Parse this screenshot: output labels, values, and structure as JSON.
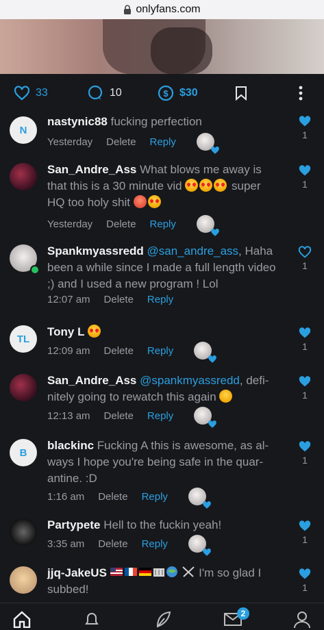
{
  "browser": {
    "url": "onlyfans.com"
  },
  "post": {
    "likes": "33",
    "comments_count": "10",
    "tip": "$30"
  },
  "comments": [
    {
      "avatar_initials": "N",
      "username": "nastynic88",
      "body": "fucking perfection",
      "time": "Yesterday",
      "delete": "Delete",
      "reply": "Reply",
      "likes": "1",
      "liked": true
    },
    {
      "username": "San_Andre_Ass",
      "body": "What blows me away is that this is a 30 minute vid",
      "body_after_emoji": "super HQ too holy shit",
      "time": "Yesterday",
      "delete": "Delete",
      "reply": "Reply",
      "likes": "1",
      "liked": true
    },
    {
      "username": "Spankmyassredd",
      "mention": "@san_andre_ass",
      "body": ", Haha been a while since I made a full length video ;) and I used a new program ! Lol",
      "time": "12:07 am",
      "delete": "Delete",
      "reply": "Reply",
      "likes": "1",
      "liked": false
    },
    {
      "avatar_initials": "TL",
      "username": "Tony L",
      "time": "12:09 am",
      "delete": "Delete",
      "reply": "Reply",
      "likes": "1",
      "liked": true
    },
    {
      "username": "San_Andre_Ass",
      "mention": "@spankmyassredd",
      "body": ", defi-nitely going to rewatch this again",
      "time": "12:13 am",
      "delete": "Delete",
      "reply": "Reply",
      "likes": "1",
      "liked": true
    },
    {
      "avatar_initials": "B",
      "username": "blackinc",
      "body": "Fucking A this is awesome, as al-ways I hope you're being safe in the quar-antine. :D",
      "time": "1:16 am",
      "delete": "Delete",
      "reply": "Reply",
      "likes": "1",
      "liked": true
    },
    {
      "username": "Partypete",
      "body": "Hell to the fuckin yeah!",
      "time": "3:35 am",
      "delete": "Delete",
      "reply": "Reply",
      "likes": "1",
      "liked": true
    },
    {
      "username": "jjq-JakeUS",
      "body": "I'm so glad I subbed!",
      "likes": "1",
      "liked": true
    }
  ],
  "nav": {
    "messages_badge": "2"
  },
  "colors": {
    "accent": "#2a9fe0",
    "background": "#17181c"
  }
}
